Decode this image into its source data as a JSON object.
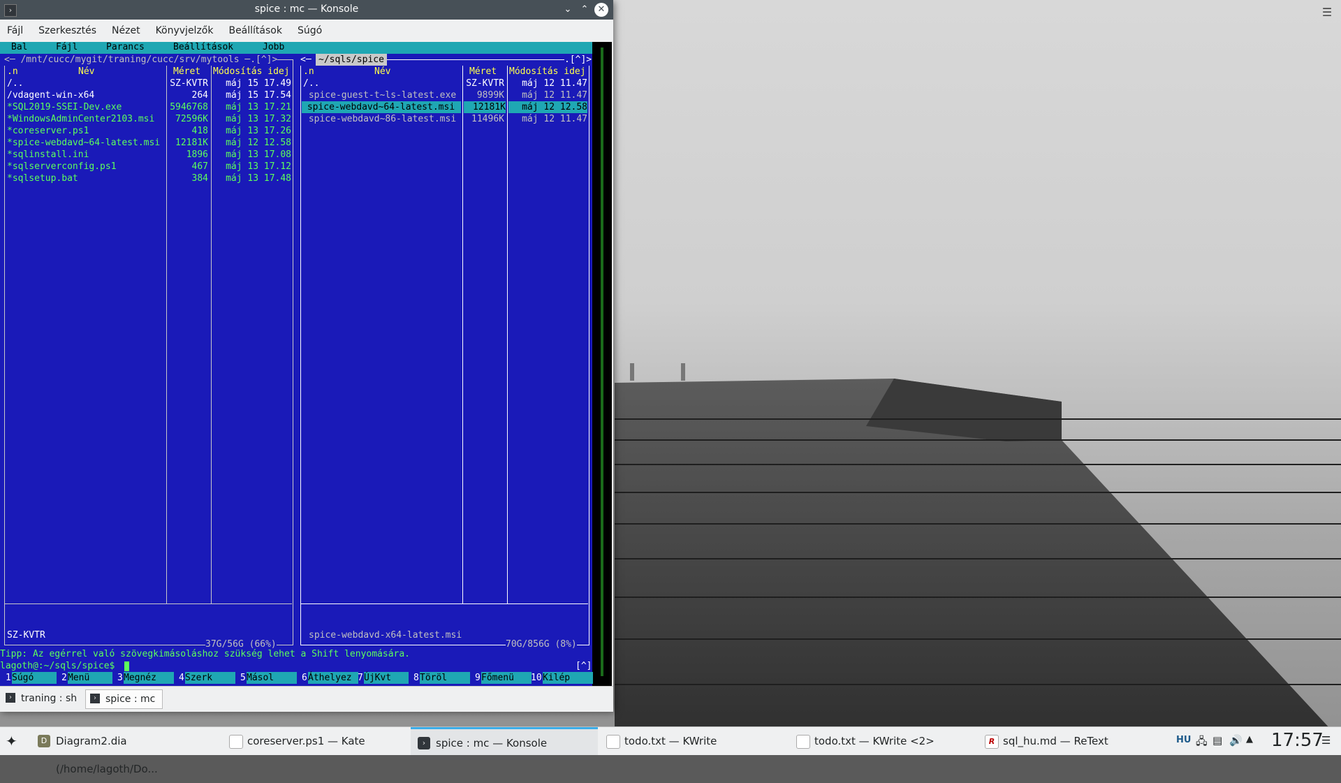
{
  "window": {
    "title": "spice : mc — Konsole"
  },
  "menubar": [
    "Fájl",
    "Szerkesztés",
    "Nézet",
    "Könyvjelzők",
    "Beállítások",
    "Súgó"
  ],
  "mc_menu": [
    "Bal",
    "Fájl",
    "Parancs",
    "Beállítások",
    "Jobb"
  ],
  "left_panel": {
    "path": "<─ /mnt/cucc/mygit/traning/cucc/srv/mytools ─.[^]>",
    "headers": {
      "n": ".n",
      "name": "Név",
      "size": "Méret",
      "mtime": "Módosítás idej"
    },
    "rows": [
      {
        "name": "/..",
        "size": "SZ-KVTR",
        "date": "máj 15 17.49"
      },
      {
        "name": "/vdagent-win-x64",
        "size": "264",
        "date": "máj 15 17.54"
      },
      {
        "name": "*SQL2019-SSEI-Dev.exe",
        "size": "5946768",
        "date": "máj 13 17.21"
      },
      {
        "name": "*WindowsAdminCenter2103.msi",
        "size": "72596K",
        "date": "máj 13 17.32"
      },
      {
        "name": "*coreserver.ps1",
        "size": "418",
        "date": "máj 13 17.26"
      },
      {
        "name": "*spice-webdavd~64-latest.msi",
        "size": "12181K",
        "date": "máj 12 12.58"
      },
      {
        "name": "*sqlinstall.ini",
        "size": "1896",
        "date": "máj 13 17.08"
      },
      {
        "name": "*sqlserverconfig.ps1",
        "size": "467",
        "date": "máj 13 17.12"
      },
      {
        "name": "*sqlsetup.bat",
        "size": "384",
        "date": "máj 13 17.48"
      }
    ],
    "status": "SZ-KVTR",
    "disk": "37G/56G (66%)"
  },
  "right_panel": {
    "path": "~/sqls/spice",
    "path_right": ".[^]>",
    "headers": {
      "n": ".n",
      "name": "Név",
      "size": "Méret",
      "mtime": "Módosítás idej"
    },
    "rows": [
      {
        "name": "/..",
        "size": "SZ-KVTR",
        "date": "máj 12 11.47"
      },
      {
        "name": " spice-guest-t~ls-latest.exe",
        "size": "9899K",
        "date": "máj 12 11.47"
      },
      {
        "name": " spice-webdavd~64-latest.msi",
        "size": "12181K",
        "date": "máj 12 12.58"
      },
      {
        "name": " spice-webdavd~86-latest.msi",
        "size": "11496K",
        "date": "máj 12 11.47"
      }
    ],
    "status": "spice-webdavd-x64-latest.msi",
    "disk": "70G/856G (8%)"
  },
  "hint": "Tipp: Az egérrel való szövegkimásoláshoz szükség lehet a Shift lenyomására.",
  "prompt": "lagoth@:~/sqls/spice$",
  "prompt_right": "[^]",
  "fkeys": [
    {
      "n": "1",
      "label": "Súgó"
    },
    {
      "n": "2",
      "label": "Menü"
    },
    {
      "n": "3",
      "label": "Megnéz"
    },
    {
      "n": "4",
      "label": "Szerk"
    },
    {
      "n": "5",
      "label": "Másol"
    },
    {
      "n": "6",
      "label": "Áthelyez"
    },
    {
      "n": "7",
      "label": "ÚjKvt"
    },
    {
      "n": "8",
      "label": "Töröl"
    },
    {
      "n": "9",
      "label": "Főmenü"
    },
    {
      "n": "10",
      "label": "Kilép"
    }
  ],
  "tabs": [
    "traning : sh",
    "spice : mc"
  ],
  "taskbar": {
    "tasks": [
      "Diagram2.dia (/home/lagoth/Do...",
      "coreserver.ps1 — Kate",
      "spice : mc — Konsole",
      "todo.txt — KWrite",
      "todo.txt — KWrite <2>",
      "sql_hu.md — ReText"
    ],
    "keyboard": "HU",
    "clock": "17:57"
  },
  "colors": {
    "mc_blue": "#1a1ab8",
    "mc_cyan": "#1fa7b3",
    "accent": "#3daee9"
  }
}
